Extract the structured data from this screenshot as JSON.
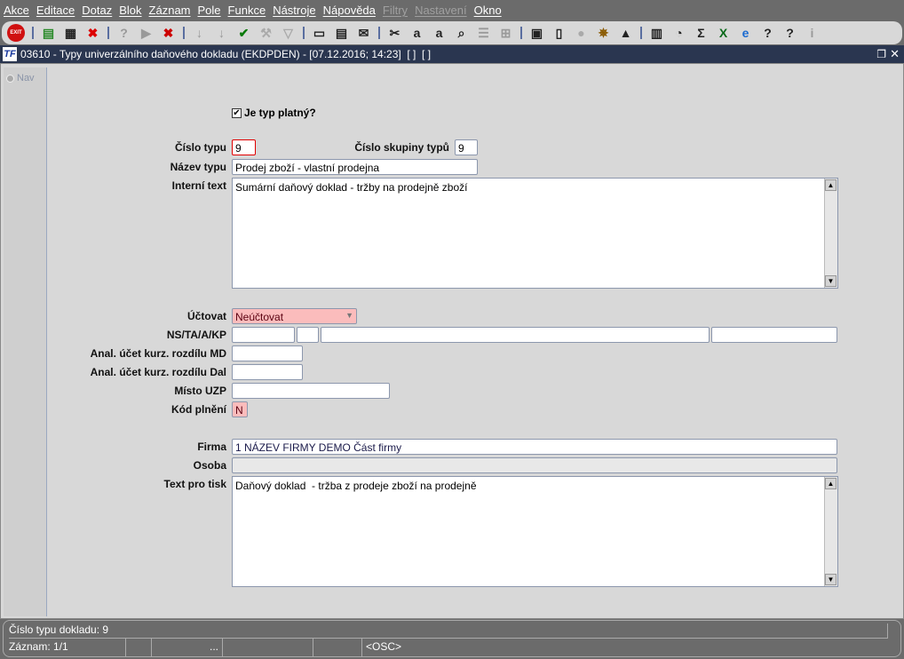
{
  "menu": [
    "Akce",
    "Editace",
    "Dotaz",
    "Blok",
    "Záznam",
    "Pole",
    "Funkce",
    "Nástroje",
    "Nápověda",
    "Filtry",
    "Nastavení",
    "Okno"
  ],
  "menu_disabled": [
    "Filtry",
    "Nastavení"
  ],
  "toolbar": {
    "exit": "EXIT",
    "icons": [
      "exit-icon",
      "sep",
      "insert-record-icon",
      "save-record-icon",
      "delete-record-icon",
      "sep",
      "query-icon",
      "execute-query-icon",
      "cancel-query-icon",
      "sep",
      "sort-asc-icon",
      "sort-desc-icon",
      "accept-icon",
      "wrench-icon",
      "filter-icon",
      "sep",
      "print-icon",
      "print-setup-icon",
      "mail-icon",
      "sep",
      "cut-icon",
      "copy-icon",
      "paste-icon",
      "zoom-icon",
      "list-icon",
      "tree-icon",
      "sep",
      "export-icon",
      "document-icon",
      "globe-icon",
      "helm-icon",
      "eye-icon",
      "sep",
      "report-icon",
      "clock-icon",
      "sum-icon",
      "excel-icon",
      "ie-icon",
      "help-question-icon",
      "help-window-icon",
      "info-icon"
    ]
  },
  "window": {
    "title": "03610 - Typy univerzálního daňového dokladu (EKDPDEN) - [07.12.2016; 14:23]  [ ]  [ ]"
  },
  "nav": {
    "label": "Nav"
  },
  "form": {
    "valid_label": "Je typ platný?",
    "valid_checked": true,
    "cislo_typu_label": "Číslo typu",
    "cislo_typu": "9",
    "cislo_skupiny_label": "Číslo skupiny typů",
    "cislo_skupiny": "9",
    "nazev_label": "Název typu",
    "nazev": "Prodej zboží - vlastní prodejna",
    "interni_label": "Interní text",
    "interni": "Sumární daňový doklad - tržby na prodejně zboží",
    "uctovat_label": "Účtovat",
    "uctovat": "Neúčtovat",
    "ns_label": "NS/TA/A/KP",
    "md_label": "Anal. účet kurz. rozdílu MD",
    "dal_label": "Anal. účet kurz. rozdílu Dal",
    "misto_label": "Místo UZP",
    "kod_label": "Kód plnění",
    "kod": "N",
    "firma_label": "Firma",
    "firma": "1 NÁZEV FIRMY DEMO Část firmy",
    "osoba_label": "Osoba",
    "tisk_label": "Text pro tisk",
    "tisk": "Daňový doklad  - tržba z prodeje zboží na prodejně"
  },
  "status": {
    "message": "Číslo typu dokladu: 9",
    "record": "Záznam: 1/1",
    "dots": "...",
    "mode": "<OSC>"
  },
  "colors": {
    "required": "#fbbcbc",
    "title": "#2a3650"
  }
}
